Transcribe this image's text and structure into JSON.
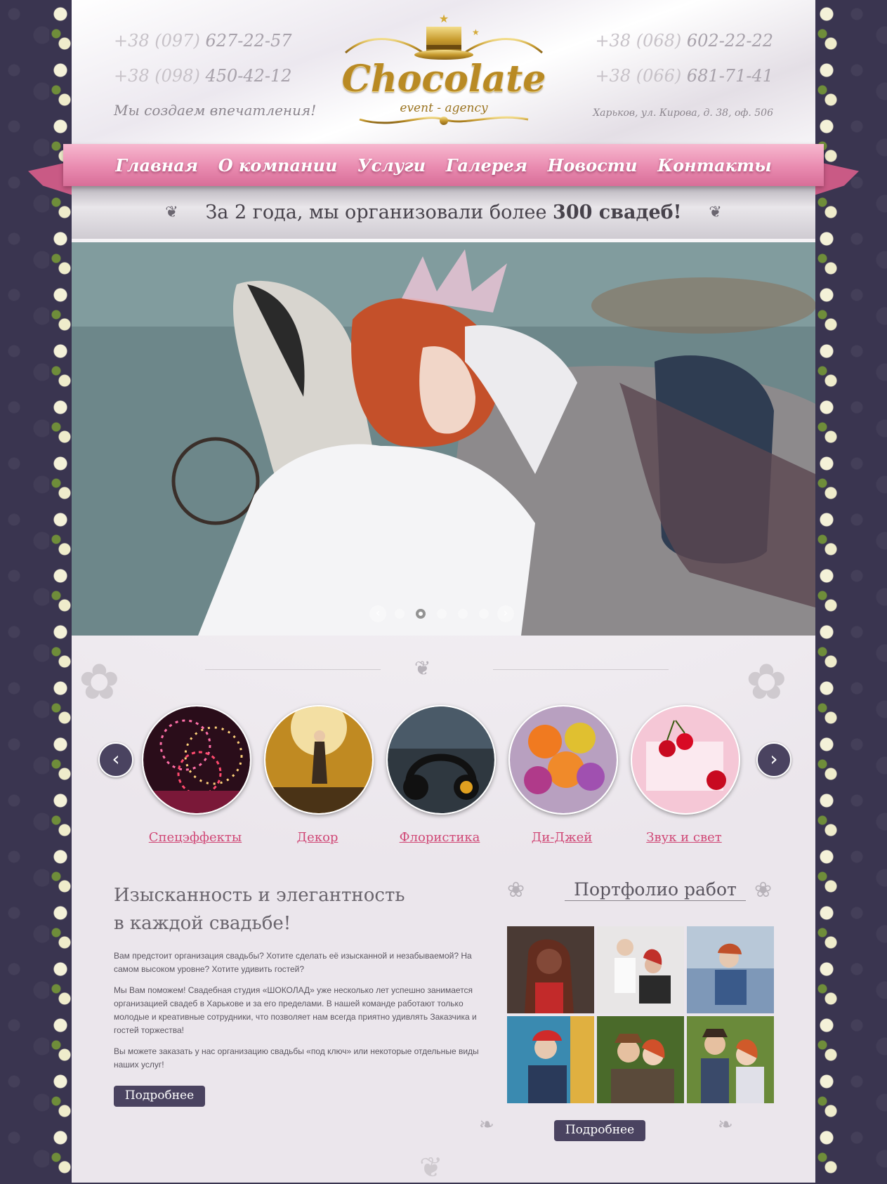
{
  "header": {
    "phones_left": [
      {
        "code": "+38 (097)",
        "number": "627-22-57"
      },
      {
        "code": "+38 (098)",
        "number": "450-42-12"
      }
    ],
    "phones_right": [
      {
        "code": "+38 (068)",
        "number": "602-22-22"
      },
      {
        "code": "+38 (066)",
        "number": "681-71-41"
      }
    ],
    "tagline": "Мы создаем впечатления!",
    "address": "Харьков, ул. Кирова, д. 38, оф. 506",
    "logo": {
      "name": "Chocolate",
      "sub": "event - agency"
    }
  },
  "nav": {
    "items": [
      "Главная",
      "О компании",
      "Услуги",
      "Галерея",
      "Новости",
      "Контакты"
    ]
  },
  "banner": {
    "text_start": "За 2 года, мы организовали более ",
    "text_bold": "300 свадеб!"
  },
  "slider": {
    "prev_icon": "‹",
    "next_icon": "›",
    "total_slides": 5,
    "active_slide": 2
  },
  "services": {
    "items": [
      {
        "label": "Спецэффекты",
        "image": "fireworks"
      },
      {
        "label": "Декор",
        "image": "stage-performer"
      },
      {
        "label": "Флористика",
        "image": "headphones-mixer"
      },
      {
        "label": "Ди-Джей",
        "image": "flower-bouquet"
      },
      {
        "label": "Звук и свет",
        "image": "cherries-ice"
      }
    ],
    "prev_icon": "‹",
    "next_icon": "›"
  },
  "about": {
    "headline_line1": "Изысканность и элегантность",
    "headline_line2": "в каждой свадьбе!",
    "paragraphs": [
      "Вам предстоит организация свадьбы? Хотите сделать её изысканной и незабываемой? На самом высоком уровне? Хотите удивить гостей?",
      "Мы Вам поможем! Свадебная студия «ШОКОЛАД» уже несколько лет успешно занимается организацией свадеб в Харькове и за его пределами. В нашей команде работают только молодые и креативные сотрудники, что позволяет нам всегда приятно удивлять Заказчика и гостей торжества!",
      "Вы можете заказать у нас организацию свадьбы «под ключ» или некоторые отдельные виды наших услуг!"
    ],
    "more_label": "Подробнее"
  },
  "portfolio": {
    "title": "Портфолио работ",
    "more_label": "Подробнее",
    "photos": [
      "woman-red-hair-dark",
      "couple-studio-white",
      "girl-cafe-blue",
      "woman-retro-headscarf",
      "couple-kiss-hat",
      "couple-outdoor-hat"
    ]
  },
  "colors": {
    "nav_pink": "#e98bb0",
    "accent_link": "#d04876",
    "button_dark": "#4a4360",
    "background_dark": "#3a3550"
  }
}
